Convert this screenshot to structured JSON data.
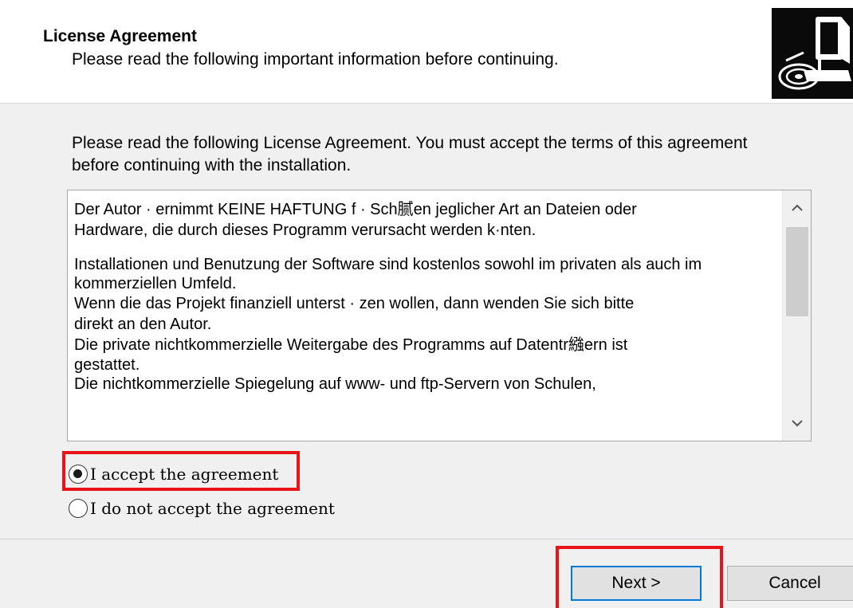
{
  "header": {
    "title": "License Agreement",
    "subtitle": "Please read the following important information before continuing."
  },
  "intro": "Please read the following License Agreement. You must accept the terms of this agreement before continuing with the installation.",
  "license": {
    "lines": [
      "Der Autor  · ernimmt KEINE HAFTUNG f ·  Sch腻en jeglicher Art an Dateien oder",
      "Hardware, die durch dieses Programm verursacht werden k·nten.",
      "Installationen und Benutzung der Software sind kostenlos sowohl im privaten als auch im kommerziellen Umfeld.",
      "Wenn die das Projekt finanziell unterst · zen wollen, dann wenden Sie sich bitte",
      "direkt an den Autor.",
      "Die private nichtkommerzielle Weitergabe des Programms auf Datentr繈ern ist",
      "gestattet.",
      "Die nichtkommerzielle Spiegelung auf www- und ftp-Servern von Schulen,"
    ]
  },
  "radios": {
    "accept_label": "I accept the agreement",
    "decline_label": "I do not accept the agreement",
    "selected": "accept"
  },
  "buttons": {
    "next_label": "Next >",
    "cancel_label": "Cancel"
  },
  "icons": {
    "installer": "installer-computer-cd-icon",
    "scroll_up": "chevron-up-icon",
    "scroll_down": "chevron-down-icon"
  },
  "colors": {
    "highlight": "#e8141a",
    "focus_border": "#0078d7",
    "header_bg": "#ffffff",
    "dialog_bg": "#f0f0f0"
  }
}
